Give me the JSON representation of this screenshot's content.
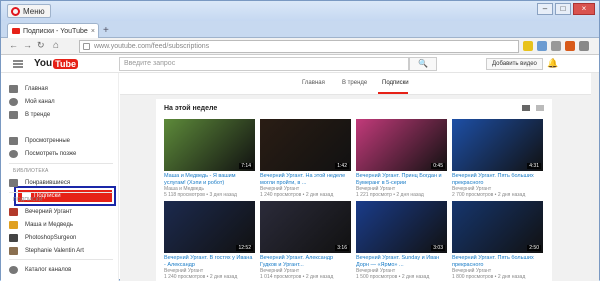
{
  "browser": {
    "menu_label": "Меню",
    "tab_title": "Подписки - YouTube",
    "tab_close": "×",
    "new_tab": "+",
    "url": "www.youtube.com/feed/subscriptions",
    "nav": {
      "back": "←",
      "forward": "→",
      "reload": "↻",
      "home": "⌂"
    },
    "window": {
      "minimize": "–",
      "maximize": "□",
      "close": "×"
    }
  },
  "youtube": {
    "logo_you": "You",
    "logo_tube": "Tube",
    "search_placeholder": "Введите запрос",
    "search_icon": "🔍",
    "upload_label": "Добавить видео",
    "bell_icon": "🔔"
  },
  "sidebar": {
    "items": [
      {
        "label": "Главная",
        "icon": "home-icon",
        "color": "#777777"
      },
      {
        "label": "Мой канал",
        "icon": "user-icon",
        "color": "#777777"
      },
      {
        "label": "В тренде",
        "icon": "fire-icon",
        "color": "#777777"
      },
      {
        "label": "Подписки",
        "icon": "subscriptions-icon",
        "color": "#e62117",
        "active": true
      },
      {
        "label": "Просмотренные",
        "icon": "history-icon",
        "color": "#777777"
      },
      {
        "label": "Посмотреть позже",
        "icon": "clock-icon",
        "color": "#777777"
      }
    ],
    "library_header": "Библиотека",
    "library_items": [
      {
        "label": "Понравившиеся",
        "icon": "thumbs-up-icon",
        "color": "#777777"
      }
    ],
    "subs_header": "Подписки",
    "subs_items": [
      {
        "label": "Вечерний Ургант",
        "color": "#b23a2b"
      },
      {
        "label": "Маша и Медведь",
        "color": "#e0a020"
      },
      {
        "label": "PhotoshopSurgeon",
        "color": "#444444"
      },
      {
        "label": "Stephanie Valentin Art",
        "color": "#8a6f50"
      }
    ],
    "catalog": {
      "label": "Каталог каналов",
      "icon": "plus-circle-icon",
      "color": "#777777"
    }
  },
  "content": {
    "tabs": [
      "Главная",
      "В тренде",
      "Подписки"
    ],
    "active_tab": "Подписки",
    "section_title": "На этой неделе",
    "videos": [
      {
        "title": "Маша и Медведь - Я вашим услугам! (Хэпи и робот)",
        "channel": "Маша и Медведь",
        "meta": "5 118 просмотров • 3 дня назад",
        "duration": "7:14",
        "color": "#5d8a3a"
      },
      {
        "title": "Вечерний Ургант. На этой неделе могли пройти, в ...",
        "channel": "Вечерний Ургант",
        "meta": "1 240 просмотров • 2 дня назад",
        "duration": "1:42",
        "color": "#2a1d14"
      },
      {
        "title": "Вечерний Ургант. Принц Богдан и Бумеранг в 5-серии",
        "channel": "Вечерний Ургант",
        "meta": "1 221 просмотр • 2 дня назад",
        "duration": "0:45",
        "color": "#c23a7a"
      },
      {
        "title": "Вечерний Ургант. Пять больших прекрасного",
        "channel": "Вечерний Ургант",
        "meta": "2 700 просмотров • 2 дня назад",
        "duration": "4:31",
        "color": "#1d4fa6"
      },
      {
        "title": "Вечерний Ургант. В гостях у Ивана - Александр",
        "channel": "Вечерний Ургант",
        "meta": "1 240 просмотров • 2 дня назад",
        "duration": "12:52",
        "color": "#1c2a4e"
      },
      {
        "title": "Вечерний Ургант. Александр Гудков и Ургант...",
        "channel": "Вечерний Ургант",
        "meta": "1 014 просмотров • 2 дня назад",
        "duration": "3:16",
        "color": "#2b2b3a"
      },
      {
        "title": "Вечерний Ургант. Sunday и Иван Дорн — «Ярмо» ...",
        "channel": "Вечерний Ургант",
        "meta": "1 500 просмотров • 2 дня назад",
        "duration": "3:03",
        "color": "#1a3c8a"
      },
      {
        "title": "Вечерний Ургант. Пять больших прекрасного",
        "channel": "Вечерний Ургант",
        "meta": "1 800 просмотров • 2 дня назад",
        "duration": "2:50",
        "color": "#16366e"
      }
    ]
  }
}
